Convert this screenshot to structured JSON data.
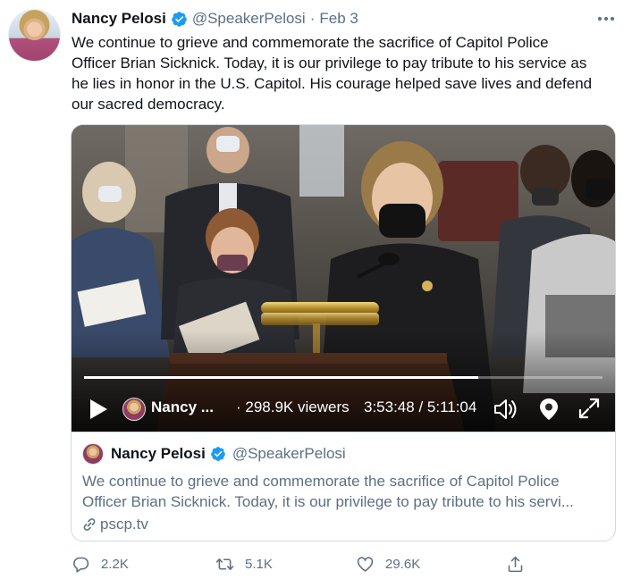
{
  "tweet": {
    "author_name": "Nancy Pelosi",
    "handle": "@SpeakerPelosi",
    "separator": "·",
    "date": "Feb 3",
    "text_lines": [
      "We continue to grieve and commemorate the sacrifice of Capitol Police",
      "Officer Brian Sicknick. Today, it is our privilege to pay tribute to his service as",
      "he lies in honor in the U.S. Capitol. His courage helped save lives and defend",
      "our sacred democracy."
    ]
  },
  "video": {
    "broadcaster": "Nancy ...",
    "viewers": "· 298.9K viewers",
    "time": "3:53:48 / 5:11:04",
    "progress_fraction": 0.76
  },
  "quote_card": {
    "author_name": "Nancy Pelosi",
    "handle": "@SpeakerPelosi",
    "text_lines": [
      "We continue to grieve and commemorate the sacrifice of Capitol Police",
      "Officer Brian Sicknick. Today, it is our privilege to pay tribute to his servi..."
    ],
    "link": "pscp.tv"
  },
  "actions": {
    "replies": "2.2K",
    "retweets": "5.1K",
    "likes": "29.6K"
  },
  "colors": {
    "verified_blue": "#1d9bf0",
    "secondary_text": "#5b7083"
  },
  "icons": [
    "more-icon",
    "verified-icon",
    "play-icon",
    "volume-icon",
    "pin-icon",
    "expand-icon",
    "link-icon",
    "reply-icon",
    "retweet-icon",
    "like-icon",
    "share-icon"
  ]
}
